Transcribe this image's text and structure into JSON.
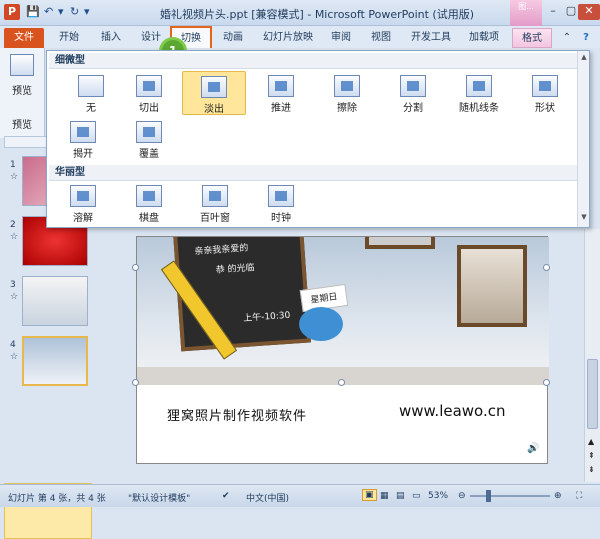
{
  "titlebar": {
    "app_icon": "P",
    "title": "婚礼视频片头.ppt [兼容模式] - Microsoft PowerPoint (试用版)",
    "context_tab_icon": "图..."
  },
  "tabs": {
    "file": "文件",
    "items": [
      "开始",
      "插入",
      "设计",
      "切换",
      "动画",
      "幻灯片放映",
      "审阅",
      "视图",
      "开发工具",
      "加载项",
      "格式"
    ],
    "active": "切换"
  },
  "callout_number": "1",
  "left_pane": {
    "label1": "预览",
    "label2": "预览"
  },
  "gallery": {
    "section1": "细微型",
    "section2": "华丽型",
    "subtle": [
      "无",
      "切出",
      "淡出",
      "推进",
      "擦除",
      "分割",
      "随机线条",
      "形状",
      "揭开",
      "覆盖"
    ],
    "exciting": [
      "溶解",
      "棋盘",
      "百叶窗",
      "时钟"
    ],
    "selected": "淡出"
  },
  "slides": [
    {
      "num": "1",
      "star": "☆"
    },
    {
      "num": "2",
      "star": "☆"
    },
    {
      "num": "3",
      "star": "☆"
    },
    {
      "num": "4",
      "star": "☆"
    }
  ],
  "slide": {
    "chalk1": "亲亲我亲爱的",
    "chalk2": "恭 的光临",
    "chalk3": "上午-10:30",
    "sign": "星期日",
    "caption": "狸窝照片制作视频软件",
    "url": "www.leawo.cn"
  },
  "status": {
    "slide_info": "幻灯片 第 4 张，共 4 张",
    "theme": "\"默认设计模板\"",
    "language": "中文(中国)",
    "zoom": "53%"
  }
}
